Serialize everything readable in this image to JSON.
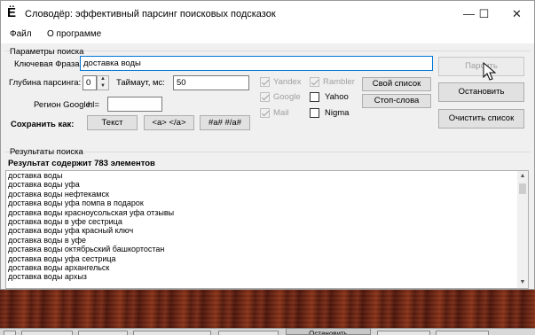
{
  "window": {
    "icon": "Ё",
    "title": "Словодёр: эффективный парсинг поисковых подсказок",
    "minimize_icon": "—",
    "maximize_icon": "☐",
    "close_icon": "✕"
  },
  "menu": [
    "Файл",
    "О программе"
  ],
  "params": {
    "group_title": "Параметры поиска",
    "keyword_label": "Ключевая Фраза:",
    "keyword_value": "доставка воды",
    "depth_label": "Глубина парсинга:",
    "depth_value": "0",
    "timeout_label": "Таймаут, мс:",
    "timeout_value": "50",
    "region_label": "Регион Google:",
    "hl_label": "hl=",
    "hl_value": "",
    "save_as_label": "Сохранить как:",
    "save_text": "Текст",
    "save_a": "<a> </a>",
    "save_hash": "#a# #/a#"
  },
  "engines": {
    "yandex": "Yandex",
    "google": "Google",
    "mail": "Mail",
    "rambler": "Rambler",
    "yahoo": "Yahoo",
    "nigma": "Nigma"
  },
  "buttons": {
    "own_list": "Свой список",
    "stop_words": "Стоп-слова",
    "parse": "Парсить",
    "stop": "Остановить",
    "clear_list": "Очистить список"
  },
  "results": {
    "group_title": "Результаты поиска",
    "summary": "Результат содержит 783 элементов",
    "items": [
      "доставка воды",
      "доставка воды уфа",
      "доставка воды нефтекамск",
      "доставка воды уфа помпа в подарок",
      "доставка воды красноусольская уфа отзывы",
      "доставка воды в уфе сестрица",
      "доставка воды уфа красный ключ",
      "доставка воды в уфе",
      "доставка воды октябрьский башкортостан",
      "доставка воды уфа сестрица",
      "доставка воды архангельск",
      "доставка воды архыз"
    ]
  },
  "taskbar": {
    "active_label": "Остановить"
  }
}
